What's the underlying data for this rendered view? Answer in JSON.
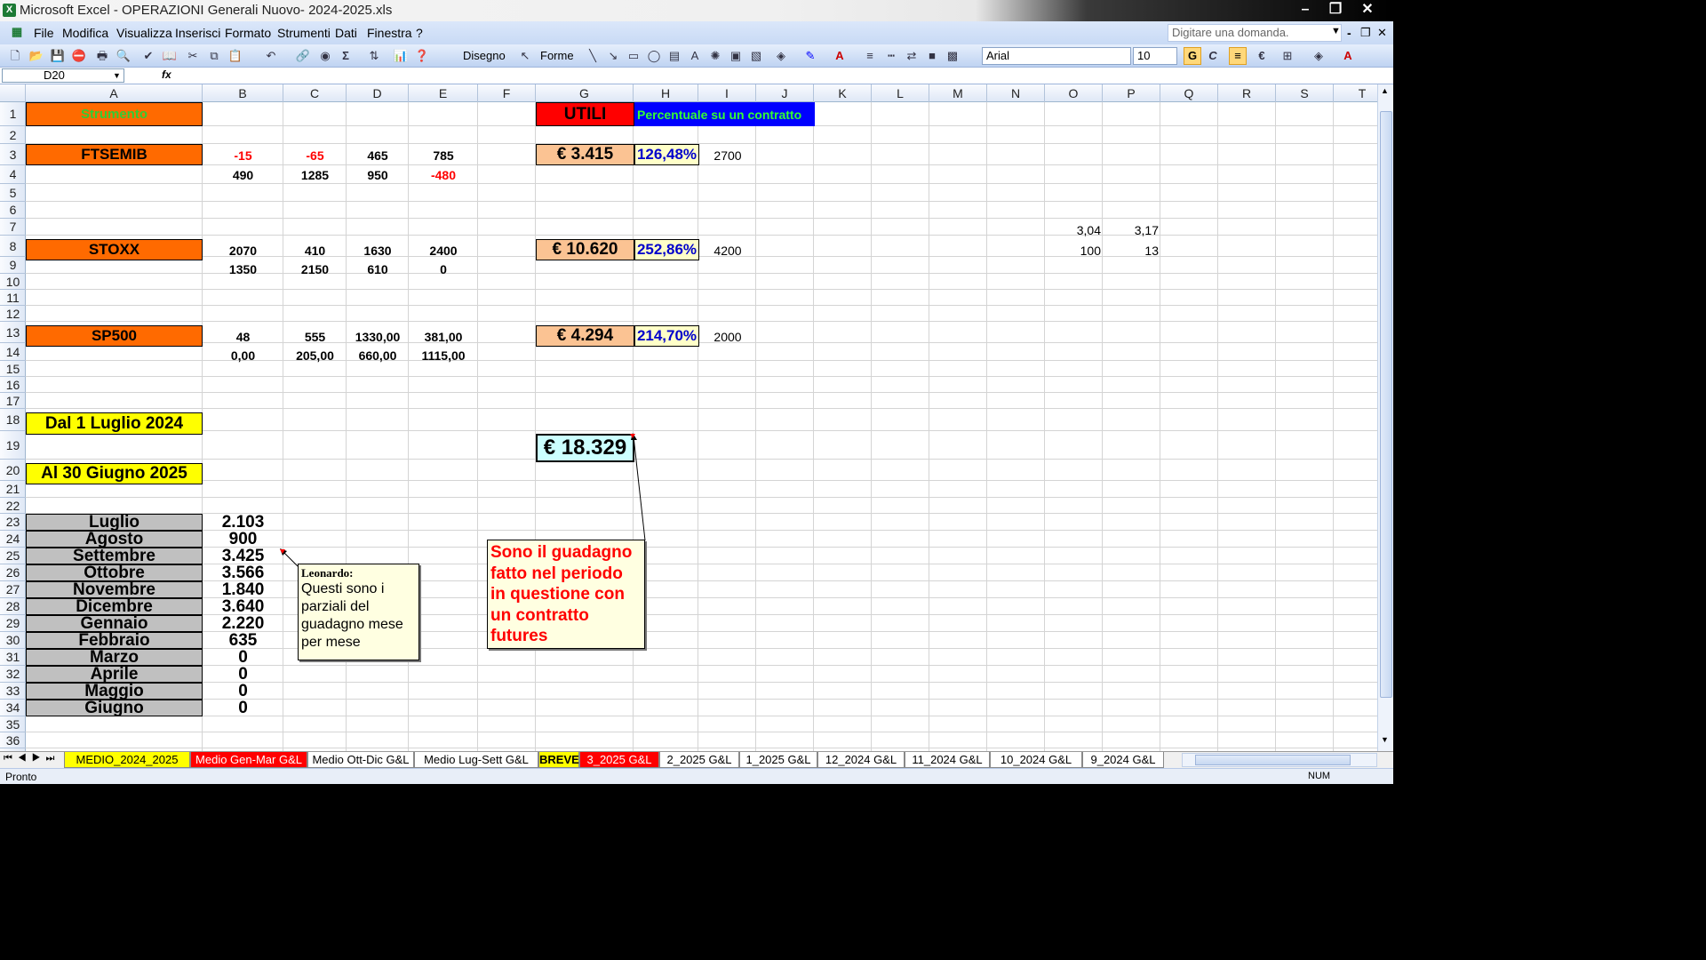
{
  "window": {
    "title": "Microsoft Excel - OPERAZIONI Generali Nuovo- 2024-2025.xls"
  },
  "menu": [
    "File",
    "Modifica",
    "Visualizza",
    "Inserisci",
    "Formato",
    "Strumenti",
    "Dati",
    "Finestra",
    "?"
  ],
  "help_placeholder": "Digitare una domanda.",
  "toolbar": {
    "draw": "Disegno",
    "shapes": "Forme",
    "font": "Arial",
    "size": "10",
    "bold": "G",
    "italic": "C"
  },
  "namebox": "D20",
  "fx": "fx",
  "columns": [
    "A",
    "B",
    "C",
    "D",
    "E",
    "F",
    "G",
    "H",
    "I",
    "J",
    "K",
    "L",
    "M",
    "N",
    "O",
    "P",
    "Q",
    "R",
    "S",
    "T"
  ],
  "cells": {
    "a1": "Strumento",
    "g1": "UTILI",
    "h1": "Percentuale su un contratto",
    "a3": "FTSEMIB",
    "b3": "-15",
    "c3": "-65",
    "d3": "465",
    "e3": "785",
    "g3": "€ 3.415",
    "h3": "126,48%",
    "i3": "2700",
    "b4": "490",
    "c4": "1285",
    "d4": "950",
    "e4": "-480",
    "o7": "3,04",
    "p7": "3,17",
    "a8": "STOXX",
    "b8": "2070",
    "c8": "410",
    "d8": "1630",
    "e8": "2400",
    "g8": "€ 10.620",
    "h8": "252,86%",
    "i8": "4200",
    "o8": "100",
    "p8": "13",
    "b9": "1350",
    "c9": "2150",
    "d9": "610",
    "e9": "0",
    "a13": "SP500",
    "b13": "48",
    "c13": "555",
    "d13": "1330,00",
    "e13": "381,00",
    "g13": "€ 4.294",
    "h13": "214,70%",
    "i13": "2000",
    "b14": "0,00",
    "c14": "205,00",
    "d14": "660,00",
    "e14": "1115,00",
    "a18": "Dal 1 Luglio  2024",
    "g19": "€ 18.329",
    "a20": "Al 30 Giugno 2025"
  },
  "months": [
    {
      "name": "Luglio",
      "value": "2.103"
    },
    {
      "name": "Agosto",
      "value": "900"
    },
    {
      "name": "Settembre",
      "value": "3.425"
    },
    {
      "name": "Ottobre",
      "value": "3.566"
    },
    {
      "name": "Novembre",
      "value": "1.840"
    },
    {
      "name": "Dicembre",
      "value": "3.640"
    },
    {
      "name": "Gennaio",
      "value": "2.220"
    },
    {
      "name": "Febbraio",
      "value": "635"
    },
    {
      "name": "Marzo",
      "value": "0"
    },
    {
      "name": "Aprile",
      "value": "0"
    },
    {
      "name": "Maggio",
      "value": "0"
    },
    {
      "name": "Giugno",
      "value": "0"
    }
  ],
  "comment1": {
    "author": "Leonardo:",
    "text": "Questi sono i parziali del guadagno mese per mese"
  },
  "comment2": {
    "text": "Sono il guadagno fatto nel periodo in questione con un contratto futures"
  },
  "tabs": [
    "MEDIO_2024_2025",
    "Medio Gen-Mar G&L",
    "Medio Ott-Dic G&L",
    "Medio Lug-Sett G&L",
    "BREVE",
    "3_2025 G&L",
    "2_2025 G&L",
    "1_2025 G&L",
    "12_2024 G&L",
    "11_2024 G&L",
    "10_2024 G&L",
    "9_2024 G&L"
  ],
  "status": {
    "left": "Pronto",
    "right": "NUM"
  },
  "colors": {
    "orange": "#ff6a00",
    "yellow": "#ffff00",
    "red": "#ff0000",
    "blue": "#0000ff",
    "peach": "#fbc393"
  }
}
